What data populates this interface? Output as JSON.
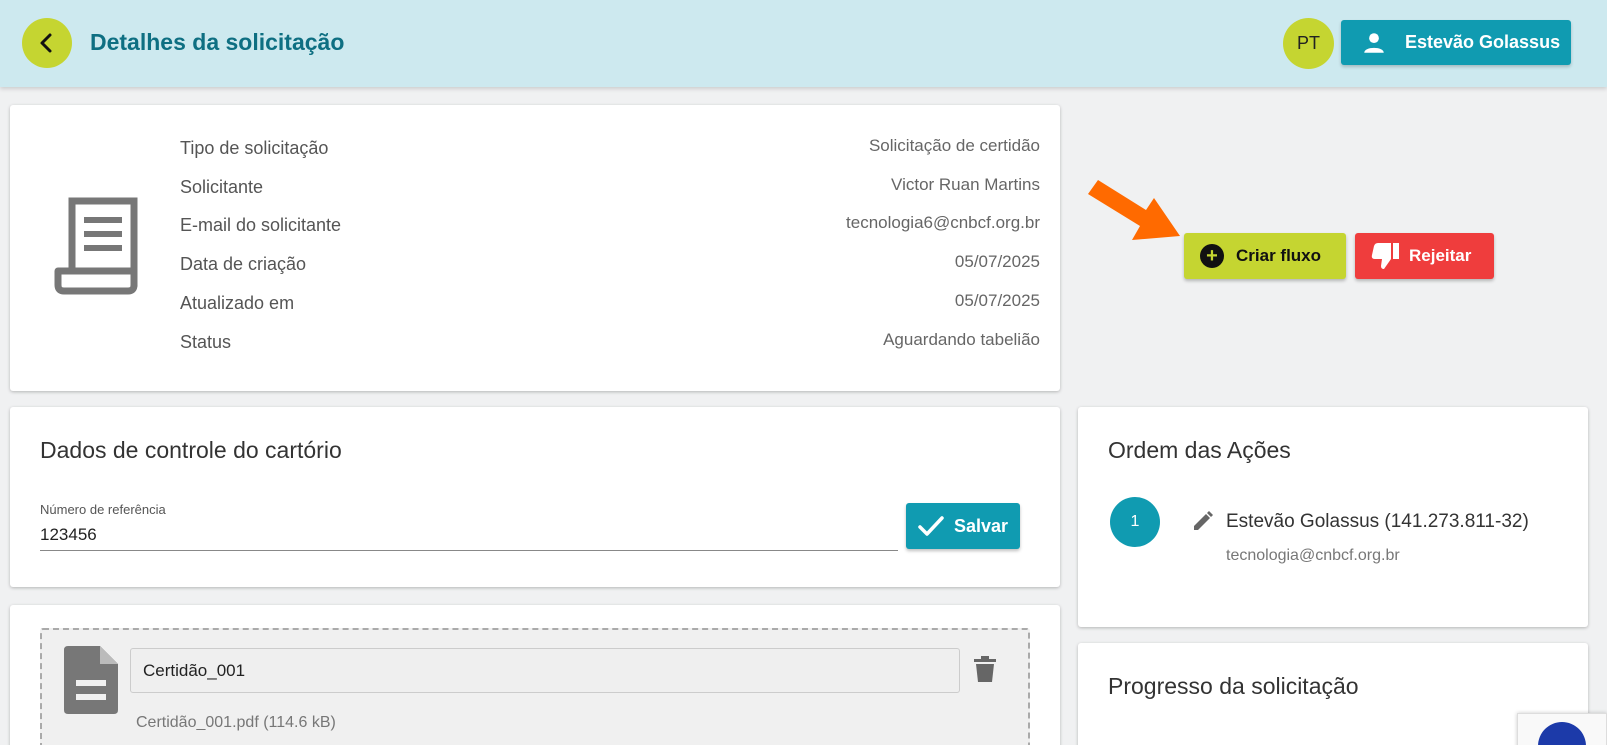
{
  "header": {
    "title": "Detalhes da solicitação",
    "lang": "PT",
    "user_name": "Estevão Golassus"
  },
  "details": {
    "rows": [
      {
        "label": "Tipo de solicitação",
        "value": "Solicitação de certidão"
      },
      {
        "label": "Solicitante",
        "value": "Victor Ruan Martins"
      },
      {
        "label": "E-mail do solicitante",
        "value": "tecnologia6@cnbcf.org.br"
      },
      {
        "label": "Data de criação",
        "value": "05/07/2025"
      },
      {
        "label": "Atualizado em",
        "value": "05/07/2025"
      },
      {
        "label": "Status",
        "value": "Aguardando tabelião"
      }
    ]
  },
  "actions": {
    "criar_label": "Criar fluxo",
    "rejeitar_label": "Rejeitar"
  },
  "controle": {
    "title": "Dados de controle do cartório",
    "field_label": "Número de referência",
    "field_value": "123456",
    "save_label": "Salvar"
  },
  "arquivos": {
    "file_name": "Certidão_001",
    "file_info": "Certidão_001.pdf (114.6 kB)"
  },
  "ordem": {
    "title": "Ordem das Ações",
    "steps": [
      {
        "number": "1",
        "name": "Estevão Golassus (141.273.811-32)",
        "email": "tecnologia@cnbcf.org.br"
      }
    ]
  },
  "progresso": {
    "title": "Progresso da solicitação"
  },
  "colors": {
    "accent_green": "#c5d531",
    "accent_teal": "#109bb1",
    "danger_red": "#ef3d3d",
    "header_bg": "#cde9ef",
    "arrow_orange": "#ff6a00"
  }
}
